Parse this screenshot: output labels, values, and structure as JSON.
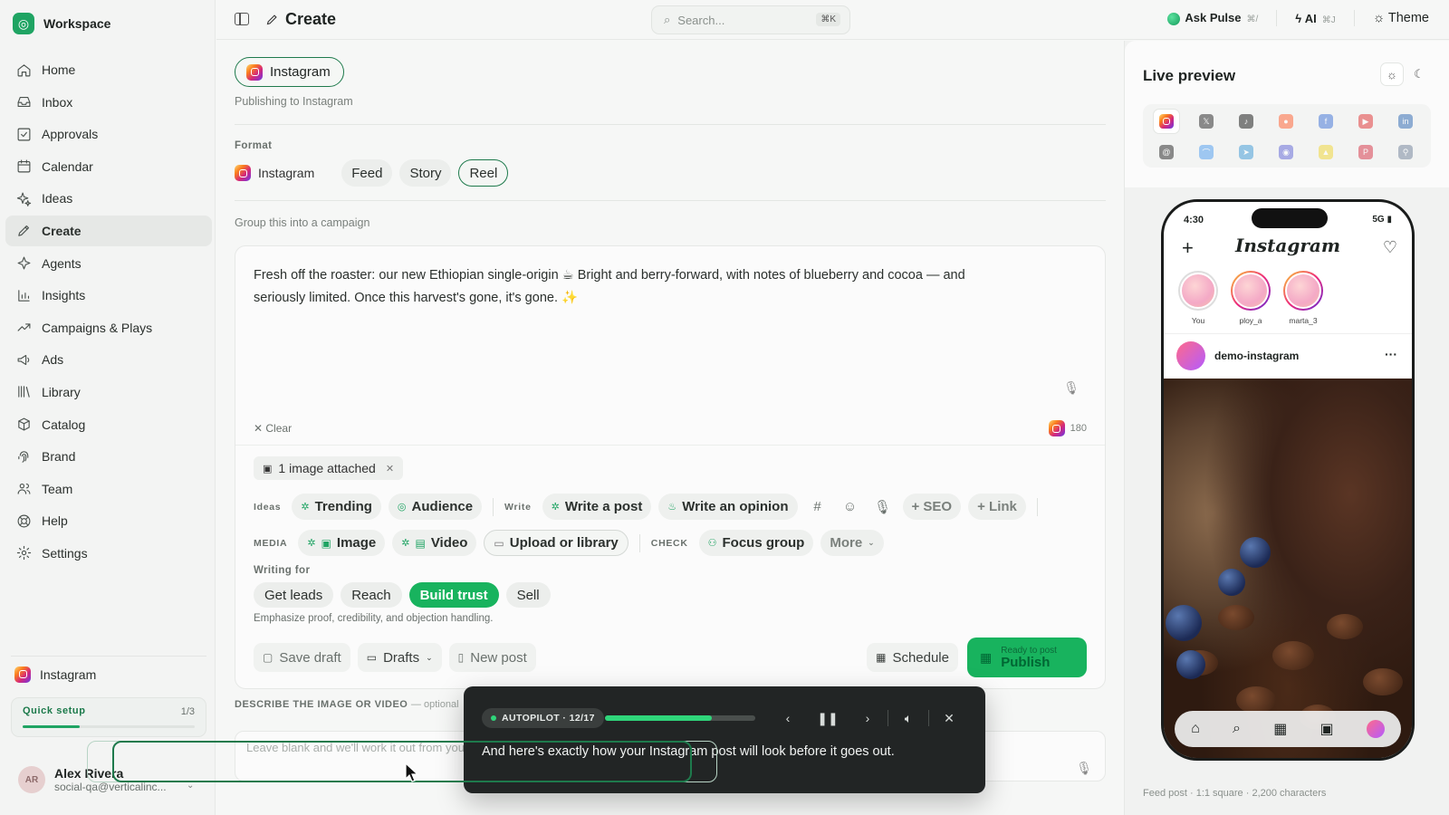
{
  "sidebar": {
    "workspace": "Workspace",
    "nav": [
      {
        "label": "Home",
        "icon": "home-icon"
      },
      {
        "label": "Inbox",
        "icon": "inbox-icon"
      },
      {
        "label": "Approvals",
        "icon": "check-square-icon"
      },
      {
        "label": "Calendar",
        "icon": "calendar-icon"
      },
      {
        "label": "Ideas",
        "icon": "sparkle-icon"
      },
      {
        "label": "Create",
        "icon": "pencil-icon",
        "active": true
      },
      {
        "label": "Agents",
        "icon": "star-icon"
      },
      {
        "label": "Insights",
        "icon": "bar-chart-icon"
      },
      {
        "label": "Campaigns & Plays",
        "icon": "trend-icon"
      },
      {
        "label": "Ads",
        "icon": "megaphone-icon"
      },
      {
        "label": "Library",
        "icon": "library-icon"
      },
      {
        "label": "Catalog",
        "icon": "package-icon"
      },
      {
        "label": "Brand",
        "icon": "fingerprint-icon"
      },
      {
        "label": "Team",
        "icon": "users-icon"
      },
      {
        "label": "Help",
        "icon": "help-icon"
      },
      {
        "label": "Settings",
        "icon": "gear-icon"
      }
    ],
    "account": "Instagram",
    "quick_setup": {
      "label": "Quick setup",
      "progress": "1/3",
      "fraction": 0.33
    },
    "user": {
      "initials": "AR",
      "name": "Alex Rivera",
      "email": "social-qa@verticalinc..."
    }
  },
  "topbar": {
    "title": "Create",
    "search_placeholder": "Search...",
    "search_kbd": "⌘K",
    "ask_pulse": "Ask Pulse",
    "ask_pulse_kbd": "⌘/",
    "ai": "AI",
    "ai_kbd": "⌘J",
    "theme": "Theme"
  },
  "main": {
    "platform_chip": "Instagram",
    "publishing_to": "Publishing to Instagram",
    "format_label": "Format",
    "format_platform": "Instagram",
    "formats": [
      "Feed",
      "Story",
      "Reel"
    ],
    "campaign_hint": "Group this into a campaign",
    "post_text": "Fresh off the roaster: our new Ethiopian single-origin ☕ Bright and berry-forward, with notes of blueberry and cocoa — and seriously limited. Once this harvest's gone, it's gone. ✨",
    "clear": "Clear",
    "char_count": "180",
    "attached": "1 image attached",
    "ideas_label": "Ideas",
    "ideas": [
      "Trending",
      "Audience"
    ],
    "write_label": "Write",
    "write": [
      "Write a post",
      "Write an opinion"
    ],
    "seo": "+ SEO",
    "link": "+ Link",
    "media_label": "MEDIA",
    "media": [
      "Image",
      "Video"
    ],
    "upload": "Upload or library",
    "check_label": "CHECK",
    "focus_group": "Focus group",
    "more": "More",
    "writing_for_label": "Writing for",
    "goals": [
      "Get leads",
      "Reach",
      "Build trust",
      "Sell"
    ],
    "goal_selected": "Build trust",
    "goal_hint": "Emphasize proof, credibility, and objection handling.",
    "save_draft": "Save draft",
    "drafts": "Drafts",
    "new_post": "New post",
    "schedule": "Schedule",
    "publish_sub": "Ready to post",
    "publish": "Publish",
    "describe_label": "DESCRIBE THE IMAGE OR VIDEO",
    "describe_optional": "— optional",
    "describe_placeholder": "Leave blank and we'll work it out from your post"
  },
  "autopilot": {
    "badge": "AUTOPILOT · 12/17",
    "progress": 0.71,
    "text": "And here's exactly how your Instagram post will look before it goes out."
  },
  "preview": {
    "title": "Live preview",
    "platforms": [
      "instagram",
      "x",
      "tiktok",
      "reddit",
      "facebook",
      "youtube",
      "linkedin",
      "threads",
      "bluesky",
      "telegram",
      "discord",
      "snapchat",
      "pinterest",
      "google-business"
    ],
    "phone": {
      "time": "4:30",
      "signal": "5G",
      "app_logo": "Instagram",
      "stories": [
        "You",
        "ploy_a",
        "marta_3"
      ],
      "handle": "demo-instagram"
    },
    "footer": "Feed post · 1:1 square · 2,200 characters"
  },
  "colors": {
    "accent": "#18b35e",
    "accent_dark": "#1e7a4c",
    "autopilot_bg": "#222525"
  }
}
